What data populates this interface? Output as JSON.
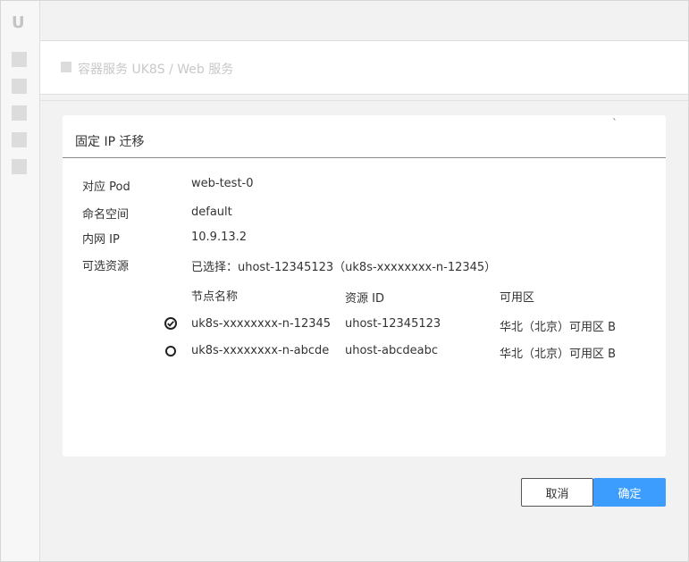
{
  "sidebar": {
    "logo": "U",
    "nav_icons": [
      "nav-square-icon",
      "nav-square-icon",
      "nav-square-icon",
      "nav-square-icon",
      "nav-square-icon"
    ]
  },
  "breadcrumb": {
    "text": "容器服务 UK8S / Web 服务"
  },
  "dialog": {
    "title": "固定 IP 迁移",
    "close_mark": "ˋ",
    "fields": {
      "pod_label": "对应 Pod",
      "pod_value": "web-test-0",
      "namespace_label": "命名空间",
      "namespace_value": "default",
      "ip_label": "内网 IP",
      "ip_value": "10.9.13.2",
      "resource_label": "可选资源",
      "selected_value": "已选择：uhost-12345123（uk8s-xxxxxxxx-n-12345）"
    },
    "table": {
      "headers": {
        "node_name": "节点名称",
        "resource_id": "资源 ID",
        "zone": "可用区"
      },
      "rows": [
        {
          "node_name": "uk8s-xxxxxxxx-n-12345",
          "resource_id": "uhost-12345123",
          "zone": "华北（北京）可用区 B",
          "selected": true
        },
        {
          "node_name": "uk8s-xxxxxxxx-n-abcde",
          "resource_id": "uhost-abcdeabc",
          "zone": "华北（北京）可用区 B",
          "selected": false
        }
      ]
    }
  },
  "buttons": {
    "cancel": "取消",
    "confirm": "确定"
  },
  "colors": {
    "primary": "#3c9dff",
    "background": "#f2f2f2"
  }
}
